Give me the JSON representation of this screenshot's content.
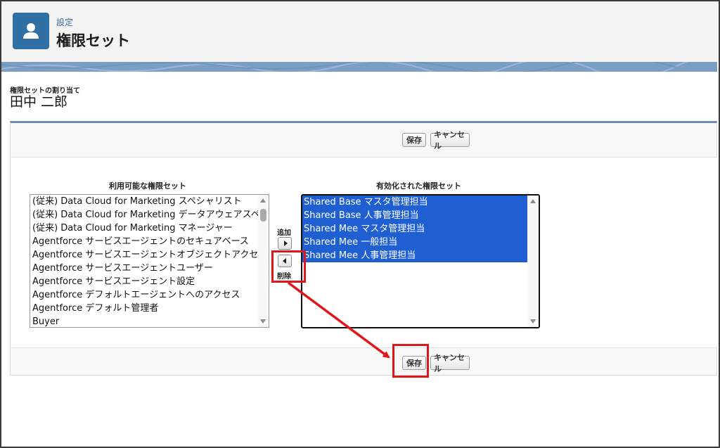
{
  "header": {
    "subtitle": "設定",
    "title": "権限セット",
    "icon": "user-icon"
  },
  "assignment": {
    "label": "権限セットの割り当て",
    "user_name": "田中 二郎"
  },
  "actions": {
    "save_label": "保存",
    "cancel_label": "キャンセル"
  },
  "available": {
    "heading": "利用可能な権限セット",
    "items": [
      "(従来) Data Cloud for Marketing スペシャリスト",
      "(従来) Data Cloud for Marketing データアウェアスペシ・",
      "(従来) Data Cloud for Marketing マネージャー",
      "Agentforce サービスエージェントのセキュアベース",
      "Agentforce サービスエージェントオブジェクトアクセス",
      "Agentforce サービスエージェントユーザー",
      "Agentforce サービスエージェント設定",
      "Agentforce デフォルトエージェントへのアクセス",
      "Agentforce デフォルト管理者",
      "Buyer"
    ]
  },
  "enabled": {
    "heading": "有効化された権限セット",
    "items": [
      "Shared Base マスタ管理担当",
      "Shared Base 人事管理担当",
      "Shared Mee マスタ管理担当",
      "Shared Mee 一般担当",
      "Shared Mee 人事管理担当"
    ]
  },
  "controls": {
    "add_label": "追加",
    "remove_label": "削除"
  },
  "colors": {
    "accent": "#2f6fa3",
    "selection": "#1f5fd1",
    "highlight": "#e0161b"
  }
}
